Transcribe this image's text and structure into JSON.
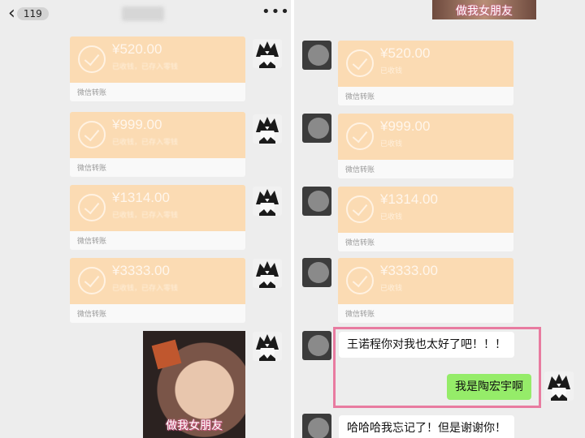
{
  "header": {
    "back_count": "119",
    "more": "•••"
  },
  "transfers_left": [
    {
      "amount": "¥520.00",
      "status": "已收钱，已存入零钱",
      "label": "微信转账"
    },
    {
      "amount": "¥999.00",
      "status": "已收钱，已存入零钱",
      "label": "微信转账"
    },
    {
      "amount": "¥1314.00",
      "status": "已收钱，已存入零钱",
      "label": "微信转账"
    },
    {
      "amount": "¥3333.00",
      "status": "已收钱，已存入零钱",
      "label": "微信转账"
    }
  ],
  "transfers_right": [
    {
      "amount": "¥520.00",
      "status": "已收钱",
      "label": "微信转账"
    },
    {
      "amount": "¥999.00",
      "status": "已收钱",
      "label": "微信转账"
    },
    {
      "amount": "¥1314.00",
      "status": "已收钱",
      "label": "微信转账"
    },
    {
      "amount": "¥3333.00",
      "status": "已收钱",
      "label": "微信转账"
    }
  ],
  "sticker_caption": "做我女朋友",
  "messages": {
    "received_1": "王诺程你对我也太好了吧！！！",
    "sent_1": "我是陶宏宇啊",
    "received_2": "哈哈哈我忘记了！但是谢谢你！"
  },
  "colors": {
    "transfer_orange": "#fbdbb3",
    "sent_bubble": "#95ec69",
    "highlight_border": "#e87ba0",
    "chat_background": "#ededed"
  }
}
